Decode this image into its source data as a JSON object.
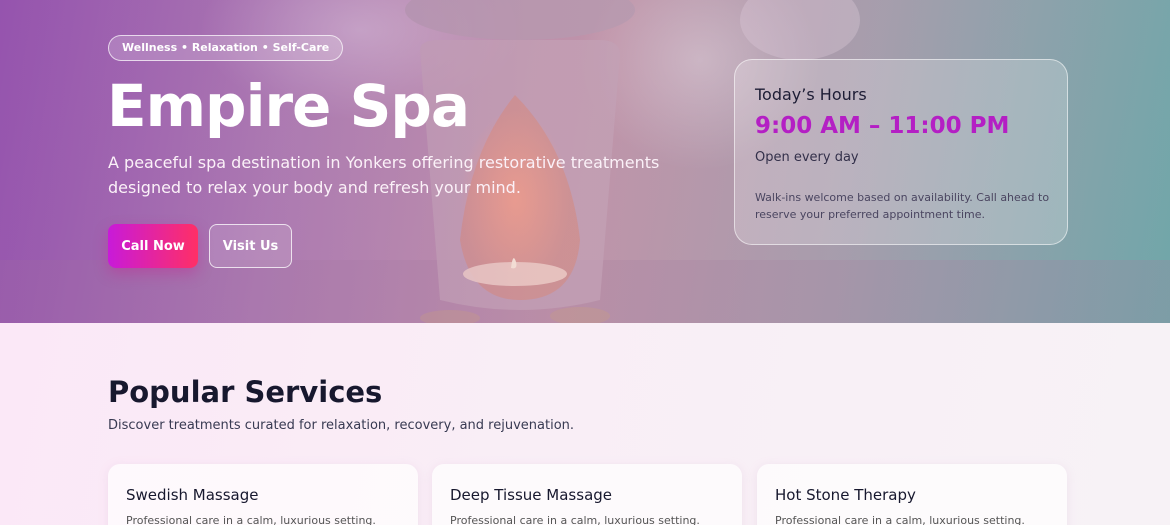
{
  "hero": {
    "tagline": "Wellness • Relaxation • Self-Care",
    "title": "Empire Spa",
    "subtitle": "A peaceful spa destination in Yonkers offering restorative treatments designed to relax your body and refresh your mind.",
    "call_label": "Call Now",
    "visit_label": "Visit Us"
  },
  "hours": {
    "title": "Today’s Hours",
    "time": "9:00 AM – 11:00 PM",
    "open_text": "Open every day",
    "note": "Walk-ins welcome based on availability. Call ahead to reserve your preferred appointment time."
  },
  "services": {
    "title": "Popular Services",
    "subtitle": "Discover treatments curated for relaxation, recovery, and rejuvenation.",
    "items": [
      {
        "name": "Swedish Massage",
        "desc": "Professional care in a calm, luxurious setting."
      },
      {
        "name": "Deep Tissue Massage",
        "desc": "Professional care in a calm, luxurious setting."
      },
      {
        "name": "Hot Stone Therapy",
        "desc": "Professional care in a calm, luxurious setting."
      }
    ]
  },
  "colors": {
    "accent_start": "#c81ad9",
    "accent_end": "#ff2f66",
    "hours_time": "#b41fc4",
    "heading": "#17182e"
  }
}
